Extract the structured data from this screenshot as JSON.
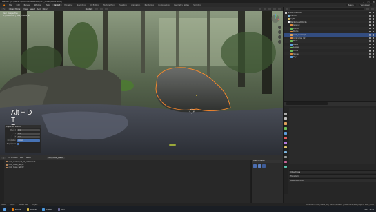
{
  "window": {
    "title": "Blender* [C:\\Users\\...\\Documents\\Blender\\rock_forest_scene.blend]",
    "controls": [
      "–",
      "□",
      "✕"
    ]
  },
  "menubar": {
    "menus": [
      "File",
      "Edit",
      "Render",
      "Window",
      "Help"
    ],
    "workspaces": [
      "Layout",
      "Modeling",
      "Sculpting",
      "UV Editing",
      "Texture Paint",
      "Shading",
      "Animation",
      "Rendering",
      "Compositing",
      "Geometry Nodes",
      "Scripting"
    ],
    "active_workspace": "Layout",
    "scene": "Scene",
    "view_layer": "ViewLayer"
  },
  "viewport_header": {
    "mode": "Object Mode",
    "menus": [
      "View",
      "Select",
      "Add",
      "Object"
    ],
    "transform": "Global"
  },
  "viewport": {
    "info": [
      "User Perspective",
      "(1) Collection | rock_cluster_01"
    ],
    "hotkeys": [
      "Alt + D",
      "T",
      "Z"
    ]
  },
  "op_panel": {
    "title": "Duplicate Linked",
    "rows": [
      {
        "label": "Move X",
        "value": "0 m"
      },
      {
        "label": "Y",
        "value": "0 m"
      },
      {
        "label": "Z",
        "value": "0 m"
      },
      {
        "label": "Orientation",
        "value": "Global"
      },
      {
        "label": "Proportional",
        "value": ""
      }
    ]
  },
  "outliner": {
    "search_placeholder": "",
    "items": [
      {
        "label": "Scene Collection",
        "color": "#cccccc",
        "selected": false
      },
      {
        "label": "Camera",
        "color": "#7db6e0",
        "selected": false
      },
      {
        "label": "Light",
        "color": "#e0c46b",
        "selected": false
      },
      {
        "label": "Background_Rocks",
        "color": "#ffffff",
        "selected": false
      },
      {
        "label": "Ground",
        "color": "#e08a3c",
        "selected": false
      },
      {
        "label": "Plants",
        "color": "#6bbf59",
        "selected": false
      },
      {
        "label": "Rocks",
        "color": "#e08a3c",
        "selected": false
      },
      {
        "label": "rock_cluster_01",
        "color": "#e0a25c",
        "selected": true
      },
      {
        "label": "rock_large_02",
        "color": "#e08a3c",
        "selected": false
      },
      {
        "label": "Trees",
        "color": "#6bbf59",
        "selected": false
      },
      {
        "label": "Water",
        "color": "#5c9fe0",
        "selected": false
      },
      {
        "label": "Leaves",
        "color": "#6bbf59",
        "selected": false
      },
      {
        "label": "Ferns",
        "color": "#6bbf59",
        "selected": false
      },
      {
        "label": "Stones",
        "color": "#e08a3c",
        "selected": false
      },
      {
        "label": "Sky",
        "color": "#5c9fe0",
        "selected": false
      }
    ]
  },
  "props": {
    "tab_colors": [
      "#aaa",
      "#c0c0c0",
      "#e0a25c",
      "#6bbf59",
      "#5c9fe0",
      "#e05c5c",
      "#b279e0",
      "#e0c46b",
      "#7db6e0",
      "#999999",
      "#cc6699",
      "#5cc5b0"
    ]
  },
  "rb_panels": [
    "Object Data",
    "Transform",
    "Asset Metadata"
  ],
  "timeline_header": {
    "editor": "File Browser",
    "menus": [
      "View",
      "Select"
    ],
    "path": "rock_forest_assets"
  },
  "files": [
    {
      "name": "rock_cluster_set_01_LOD0.blend"
    },
    {
      "name": "rock_mesh_set_01"
    },
    {
      "name": "rock_mesh_set_02"
    }
  ],
  "asset_panel": {
    "title": "Asset Browser",
    "thumb_colors": [
      "#4b6db0",
      "#5c7fbf",
      "#3f5d99"
    ]
  },
  "statusbar": {
    "left": [
      "Select",
      "Move",
      "Rotate View",
      "Object"
    ],
    "right": "Collection | rock_cluster_01 | Verts 2,481,920 | Faces 2,456,410 | Objects 1/46 | 3.6.0"
  },
  "taskbar": {
    "apps": [
      {
        "label": "Blender",
        "color": "#e87d0d"
      },
      {
        "label": "Explorer",
        "color": "#e0c14a"
      },
      {
        "label": "Browser",
        "color": "#4a9ae0"
      },
      {
        "label": "OBS",
        "color": "#6c6c9c"
      }
    ],
    "tray": [
      "ENG",
      "14:32"
    ]
  }
}
